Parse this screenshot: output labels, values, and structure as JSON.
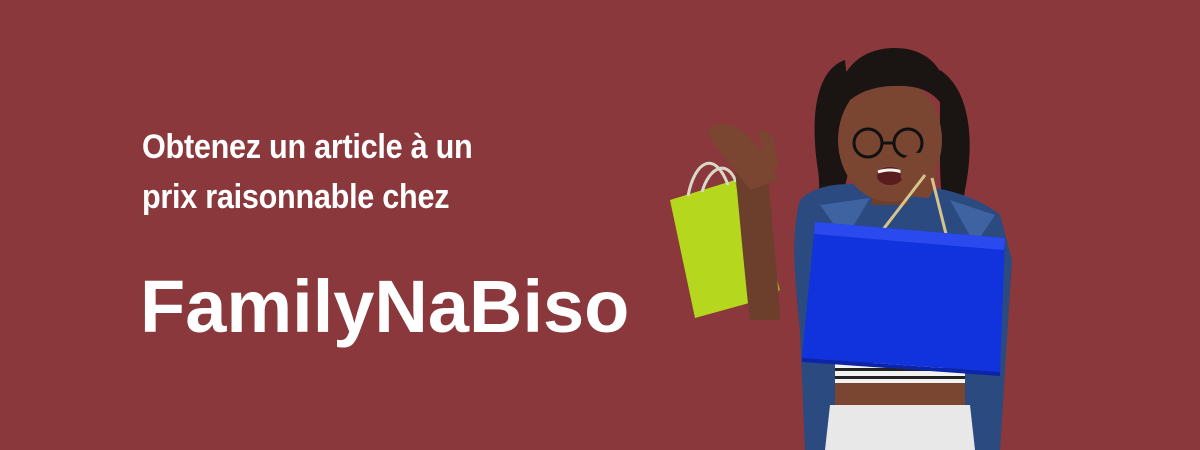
{
  "banner": {
    "tagline_line1": "Obtenez un article à un",
    "tagline_line2": "prix raisonnable chez",
    "brand": "FamilyNaBiso",
    "colors": {
      "background": "#8a383c",
      "text": "#ffffff",
      "blue_bag": "#1133dd",
      "green_bag": "#b5d81e"
    },
    "photo_icon": "woman-holding-shopping-bags"
  }
}
